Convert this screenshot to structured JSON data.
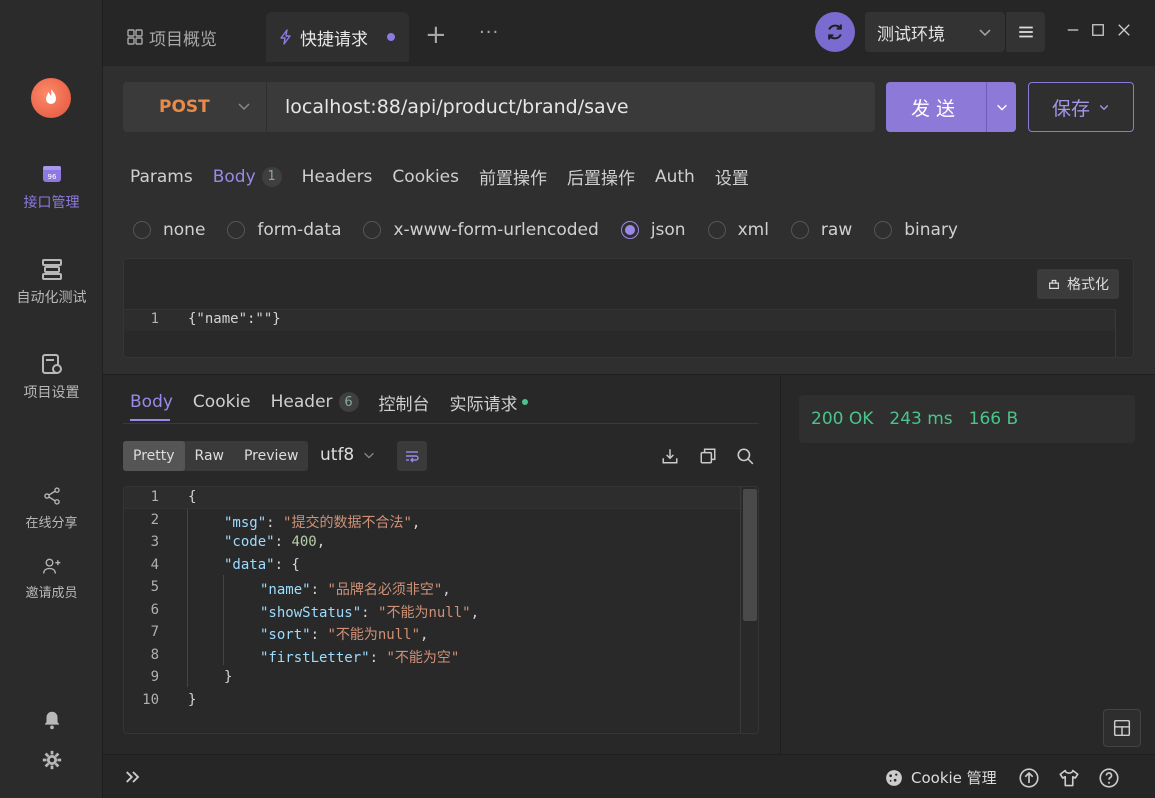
{
  "sidebar": {
    "items": [
      {
        "label": "接口管理"
      },
      {
        "label": "自动化测试"
      },
      {
        "label": "项目设置"
      },
      {
        "label": "在线分享"
      },
      {
        "label": "邀请成员"
      }
    ]
  },
  "topbar": {
    "tabs": [
      {
        "label": "项目概览"
      },
      {
        "label": "快捷请求"
      }
    ],
    "env": "测试环境"
  },
  "request": {
    "method": "POST",
    "url": "localhost:88/api/product/brand/save",
    "send_label": "发送",
    "save_label": "保存",
    "tabs": [
      {
        "label": "Params"
      },
      {
        "label": "Body",
        "badge": "1"
      },
      {
        "label": "Headers"
      },
      {
        "label": "Cookies"
      },
      {
        "label": "前置操作"
      },
      {
        "label": "后置操作"
      },
      {
        "label": "Auth"
      },
      {
        "label": "设置"
      }
    ],
    "body_types": [
      "none",
      "form-data",
      "x-www-form-urlencoded",
      "json",
      "xml",
      "raw",
      "binary"
    ],
    "body_selected": "json",
    "format_label": "格式化",
    "body_line_number": "1",
    "body_code": "{\"name\":\"\"}"
  },
  "response": {
    "tabs": [
      {
        "label": "Body"
      },
      {
        "label": "Cookie"
      },
      {
        "label": "Header",
        "badge": "6"
      },
      {
        "label": "控制台"
      },
      {
        "label": "实际请求"
      }
    ],
    "views": [
      "Pretty",
      "Raw",
      "Preview"
    ],
    "encoding": "utf8",
    "lines": [
      {
        "n": "1",
        "indent": 0,
        "parts": [
          [
            "punc",
            "{"
          ]
        ]
      },
      {
        "n": "2",
        "indent": 1,
        "parts": [
          [
            "key",
            "\"msg\""
          ],
          [
            "punc",
            ": "
          ],
          [
            "str",
            "\"提交的数据不合法\""
          ],
          [
            "punc",
            ","
          ]
        ]
      },
      {
        "n": "3",
        "indent": 1,
        "parts": [
          [
            "key",
            "\"code\""
          ],
          [
            "punc",
            ": "
          ],
          [
            "num",
            "400"
          ],
          [
            "punc",
            ","
          ]
        ]
      },
      {
        "n": "4",
        "indent": 1,
        "parts": [
          [
            "key",
            "\"data\""
          ],
          [
            "punc",
            ": {"
          ]
        ]
      },
      {
        "n": "5",
        "indent": 2,
        "parts": [
          [
            "key",
            "\"name\""
          ],
          [
            "punc",
            ": "
          ],
          [
            "str",
            "\"品牌名必须非空\""
          ],
          [
            "punc",
            ","
          ]
        ]
      },
      {
        "n": "6",
        "indent": 2,
        "parts": [
          [
            "key",
            "\"showStatus\""
          ],
          [
            "punc",
            ": "
          ],
          [
            "str",
            "\"不能为null\""
          ],
          [
            "punc",
            ","
          ]
        ]
      },
      {
        "n": "7",
        "indent": 2,
        "parts": [
          [
            "key",
            "\"sort\""
          ],
          [
            "punc",
            ": "
          ],
          [
            "str",
            "\"不能为null\""
          ],
          [
            "punc",
            ","
          ]
        ]
      },
      {
        "n": "8",
        "indent": 2,
        "parts": [
          [
            "key",
            "\"firstLetter\""
          ],
          [
            "punc",
            ": "
          ],
          [
            "str",
            "\"不能为空\""
          ]
        ]
      },
      {
        "n": "9",
        "indent": 1,
        "parts": [
          [
            "punc",
            "}"
          ]
        ]
      },
      {
        "n": "10",
        "indent": 0,
        "parts": [
          [
            "punc",
            "}"
          ]
        ]
      }
    ],
    "status": "200 OK",
    "time": "243 ms",
    "size": "166 B"
  },
  "footer": {
    "cookie_label": "Cookie 管理"
  },
  "colors": {
    "accent": "#8d7ad8",
    "method": "#e88a48",
    "success": "#4cc38a"
  }
}
